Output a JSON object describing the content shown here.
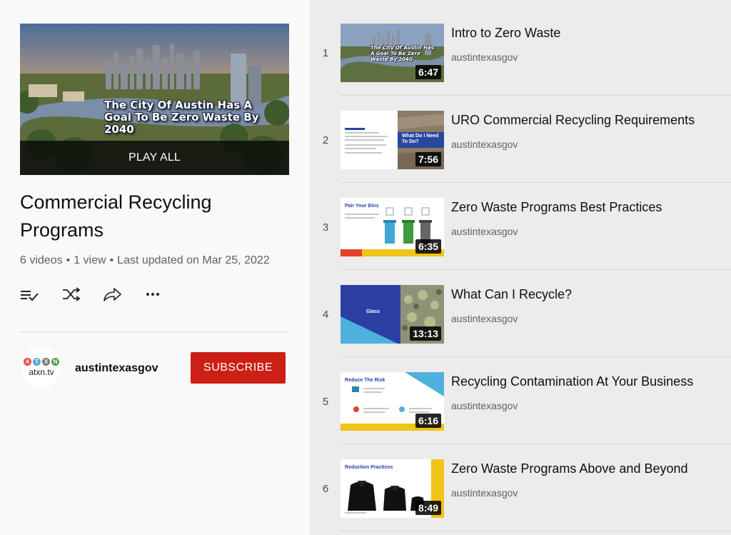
{
  "playlist": {
    "hero_caption": "The City Of Austin Has A Goal To Be Zero Waste By 2040",
    "play_all_label": "PLAY ALL",
    "title": "Commercial Recycling Programs",
    "video_count": "6 videos",
    "views": "1 view",
    "last_updated": "Last updated on Mar 25, 2022"
  },
  "channel": {
    "avatar_letters": [
      "A",
      "T",
      "X",
      "N"
    ],
    "avatar_label": "atxn.tv",
    "name": "austintexasgov",
    "subscribe_label": "SUBSCRIBE"
  },
  "colors": {
    "subscribe": "#cc1f15",
    "avatar": [
      "#e34b4b",
      "#58a7d6",
      "#7a7a7a",
      "#4aa04a"
    ]
  },
  "videos": [
    {
      "index": "1",
      "title": "Intro to Zero Waste",
      "channel": "austintexasgov",
      "duration": "6:47",
      "thumb_text": "The City Of Austin Has A Goal To Be Zero Waste By 2040"
    },
    {
      "index": "2",
      "title": "URO Commercial Recycling Requirements",
      "channel": "austintexasgov",
      "duration": "7:56",
      "thumb_text": "What Do I Need To Do?"
    },
    {
      "index": "3",
      "title": "Zero Waste Programs Best Practices",
      "channel": "austintexasgov",
      "duration": "6:35",
      "thumb_text": "Pair Your Bins"
    },
    {
      "index": "4",
      "title": "What Can I Recycle?",
      "channel": "austintexasgov",
      "duration": "13:13",
      "thumb_text": "Glass"
    },
    {
      "index": "5",
      "title": "Recycling Contamination At Your Business",
      "channel": "austintexasgov",
      "duration": "6:16",
      "thumb_text": "Reduce The Risk"
    },
    {
      "index": "6",
      "title": "Zero Waste Programs Above and Beyond",
      "channel": "austintexasgov",
      "duration": "8:49",
      "thumb_text": "Reduction Practices"
    }
  ]
}
